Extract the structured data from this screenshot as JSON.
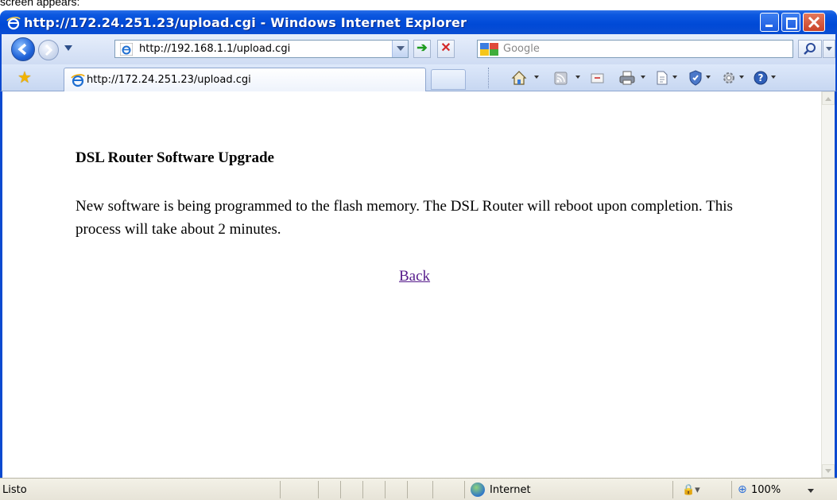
{
  "window": {
    "title": "http://172.24.251.23/upload.cgi - Windows Internet Explorer"
  },
  "cropped_text": "screen appears:",
  "navigation": {
    "address_url": "http://192.168.1.1/upload.cgi",
    "search_placeholder": "Google"
  },
  "tabs": [
    {
      "label": "http://172.24.251.23/upload.cgi"
    }
  ],
  "page": {
    "title": "DSL Router Software Upgrade",
    "message": "New software is being programmed to the flash memory. The DSL Router will reboot upon completion. This process will take about 2 minutes.",
    "back_link": "Back"
  },
  "status_bar": {
    "status": "Listo",
    "zone": "Internet",
    "zoom": "100%"
  },
  "colors": {
    "titlebar": "#0049d6",
    "visited_link": "#551a8b"
  }
}
